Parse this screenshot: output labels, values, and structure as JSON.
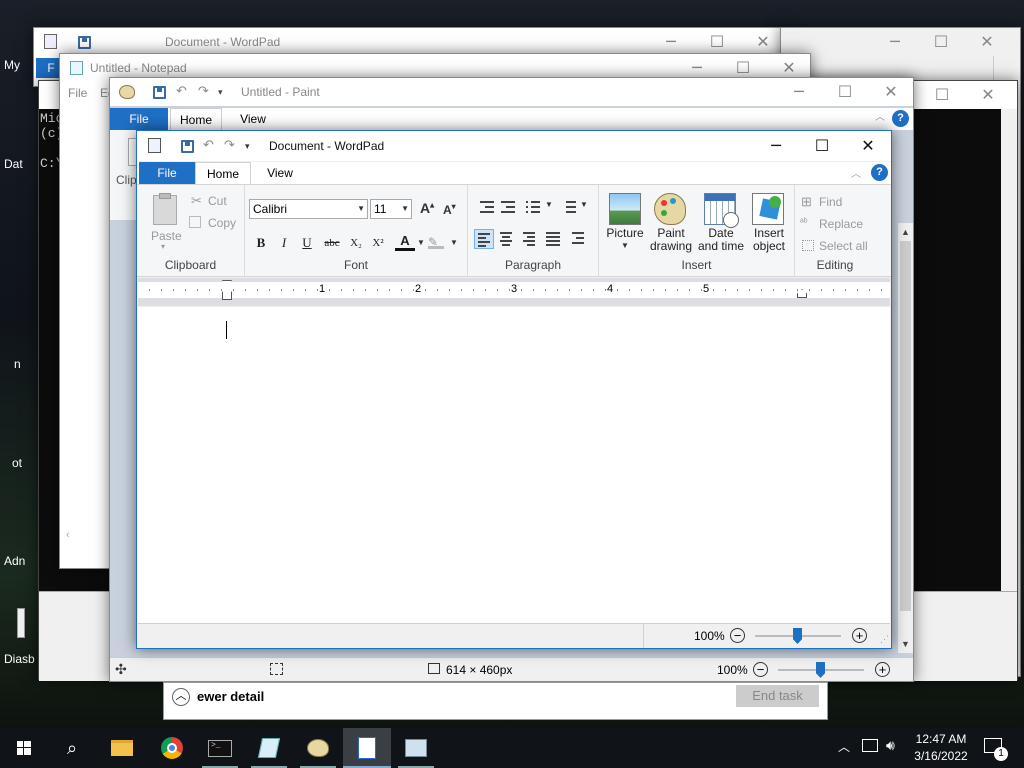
{
  "desktop": {
    "icons": [
      "My",
      "Dat",
      "n",
      "ot",
      "Adn",
      "Diasb"
    ]
  },
  "windows": {
    "wordpad_back": {
      "title": "Document - WordPad",
      "file": "F"
    },
    "notepad": {
      "title": "Untitled - Notepad",
      "menu": [
        "File",
        "Ed"
      ]
    },
    "cmd": {
      "lines": [
        "Mic",
        "(c)",
        "",
        "C:\\"
      ]
    },
    "paint": {
      "title": "Untitled - Paint",
      "tabs": [
        "File",
        "Home",
        "View"
      ],
      "clip": "Clip",
      "status_size": "614 × 460px",
      "zoom": "100%"
    },
    "taskmgr": {
      "fewer_details": "ewer detail",
      "end_task": "End task"
    },
    "wordpad": {
      "title": "Document - WordPad",
      "tabs": [
        "File",
        "Home",
        "View"
      ],
      "clipboard": {
        "paste": "Paste",
        "cut": "Cut",
        "copy": "Copy",
        "label": "Clipboard"
      },
      "font": {
        "family": "Calibri",
        "size": "11",
        "label": "Font",
        "buttons": [
          "B",
          "I",
          "U",
          "abc",
          "X₂",
          "X²",
          "A"
        ]
      },
      "paragraph": {
        "label": "Paragraph"
      },
      "insert": {
        "picture": "Picture",
        "paint_drawing": "Paint drawing",
        "date_time": "Date and time",
        "insert_object": "Insert object",
        "label": "Insert"
      },
      "editing": {
        "find": "Find",
        "replace": "Replace",
        "select_all": "Select all",
        "label": "Editing"
      },
      "ruler": [
        "1",
        "2",
        "3",
        "4",
        "5"
      ],
      "zoom": "100%"
    }
  },
  "taskbar": {
    "time": "12:47 AM",
    "date": "3/16/2022",
    "notification_count": "1"
  },
  "colors": {
    "accent": "#1f6fc5",
    "taskbar": "#101418",
    "zoom_thumb": "#1f6fc5"
  }
}
